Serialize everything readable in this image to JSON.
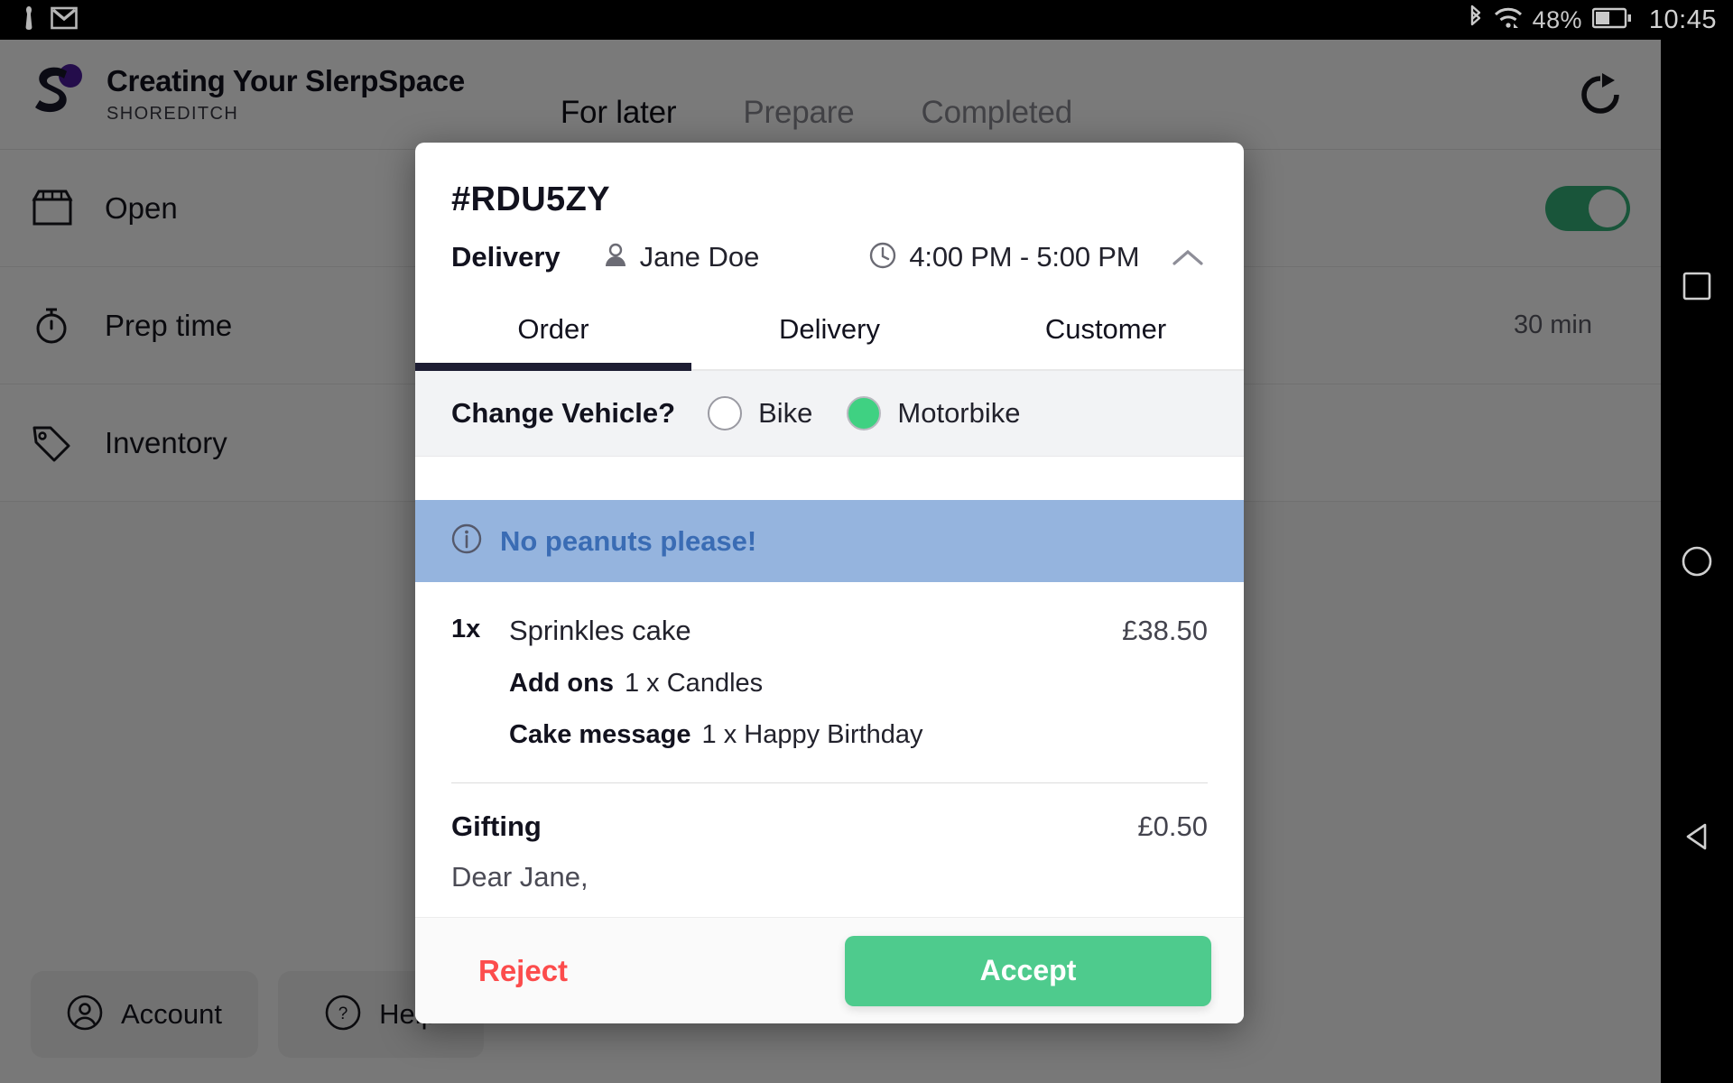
{
  "status_bar": {
    "left_icons": [
      "notification-person-icon",
      "gmail-icon"
    ],
    "bluetooth_icon": "bluetooth-icon",
    "wifi_icon": "wifi-icon",
    "battery_percent": "48%",
    "battery_icon": "battery-icon",
    "time": "10:45"
  },
  "app": {
    "logo_icon": "slerp-s-logo",
    "title": "Creating Your SlerpSpace",
    "location": "SHOREDITCH",
    "refresh_icon": "refresh-icon",
    "tabs": [
      {
        "label": "For later",
        "active": true
      },
      {
        "label": "Prepare",
        "active": false
      },
      {
        "label": "Completed",
        "active": false
      }
    ],
    "rows": [
      {
        "icon": "storefront-icon",
        "label": "Open",
        "value": "",
        "toggle": true
      },
      {
        "icon": "stopwatch-icon",
        "label": "Prep time",
        "value": "30 min",
        "toggle": false
      },
      {
        "icon": "tag-icon",
        "label": "Inventory",
        "value": "",
        "toggle": false
      }
    ],
    "bottom_buttons": [
      {
        "icon": "account-circle-icon",
        "label": "Account"
      },
      {
        "icon": "help-circle-icon",
        "label": "Help"
      }
    ]
  },
  "modal": {
    "order_code": "#RDU5ZY",
    "fulfilment_type": "Delivery",
    "customer_icon": "person-icon",
    "customer_name": "Jane Doe",
    "clock_icon": "clock-icon",
    "time_window": "4:00 PM - 5:00 PM",
    "collapse_icon": "chevron-up-icon",
    "tabs": [
      {
        "label": "Order",
        "active": true
      },
      {
        "label": "Delivery",
        "active": false
      },
      {
        "label": "Customer",
        "active": false
      }
    ],
    "vehicle": {
      "question": "Change Vehicle?",
      "options": [
        {
          "label": "Bike",
          "selected": false
        },
        {
          "label": "Motorbike",
          "selected": true
        }
      ]
    },
    "notice": {
      "icon": "info-icon",
      "text": "No peanuts please!"
    },
    "items": [
      {
        "qty": "1x",
        "name": "Sprinkles cake",
        "price": "£38.50",
        "modifiers": [
          {
            "label": "Add ons",
            "value": "1 x Candles"
          },
          {
            "label": "Cake message",
            "value": "1 x Happy Birthday"
          }
        ]
      }
    ],
    "gifting": {
      "title": "Gifting",
      "price": "£0.50",
      "message": "Dear Jane,"
    },
    "footer": {
      "reject_label": "Reject",
      "accept_label": "Accept"
    }
  },
  "nav_bar": {
    "recents_icon": "square-recents-icon",
    "home_icon": "circle-home-icon",
    "back_icon": "triangle-back-icon"
  },
  "colors": {
    "accept_green": "#4ecb8d",
    "reject_red": "#fc4c4c",
    "notice_bg": "#95b4de",
    "notice_text": "#3a6cb4",
    "tab_underline": "#1d1d33",
    "toggle_green": "#35b27a",
    "logo_purple": "#4b1d9e"
  }
}
